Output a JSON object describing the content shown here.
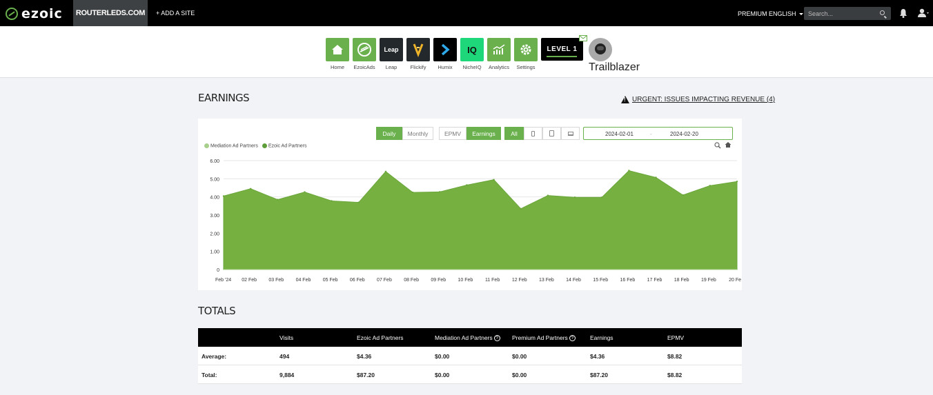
{
  "topbar": {
    "logo_text": "ezoic",
    "site": "ROUTERLEDS.COM",
    "add_site": "+ ADD A SITE",
    "premium": "PREMIUM",
    "language": "ENGLISH",
    "search_placeholder": "Search..."
  },
  "apps": [
    {
      "label": "Home",
      "icon": "home-icon"
    },
    {
      "label": "EzoicAds",
      "icon": "ezoicads-icon"
    },
    {
      "label": "Leap",
      "icon": "leap-icon",
      "tile_text": "Leap"
    },
    {
      "label": "Flickify",
      "icon": "flickify-icon"
    },
    {
      "label": "Humix",
      "icon": "humix-icon"
    },
    {
      "label": "NicheIQ",
      "icon": "nicheiq-icon",
      "tile_text": "IQ"
    },
    {
      "label": "Analytics",
      "icon": "analytics-icon"
    },
    {
      "label": "Settings",
      "icon": "gear-icon"
    }
  ],
  "level_badge": "LEVEL 1",
  "trailblazer_label": "Trailblazer",
  "earnings": {
    "title": "EARNINGS",
    "urgent": "URGENT: ISSUES IMPACTING REVENUE (4)",
    "toggles": {
      "daily": "Daily",
      "monthly": "Monthly",
      "epmv": "EPMV",
      "earnings": "Earnings",
      "all": "All"
    },
    "date_from": "2024-02-01",
    "date_sep": "-",
    "date_to": "2024-02-20",
    "legend": [
      "Mediation Ad Partners",
      "Ezoic Ad Partners"
    ]
  },
  "chart_data": {
    "type": "area",
    "x": [
      "Feb '24",
      "02 Feb",
      "03 Feb",
      "04 Feb",
      "05 Feb",
      "06 Feb",
      "07 Feb",
      "08 Feb",
      "09 Feb",
      "10 Feb",
      "11 Feb",
      "12 Feb",
      "13 Feb",
      "14 Feb",
      "15 Feb",
      "16 Feb",
      "17 Feb",
      "18 Feb",
      "19 Feb",
      "20 Fe"
    ],
    "series": [
      {
        "name": "Mediation Ad Partners",
        "values": [
          0,
          0,
          0,
          0,
          0,
          0,
          0,
          0,
          0,
          0,
          0,
          0,
          0,
          0,
          0,
          0,
          0,
          0,
          0,
          0
        ]
      },
      {
        "name": "Ezoic Ad Partners",
        "values": [
          4.05,
          4.45,
          3.85,
          4.27,
          3.78,
          3.7,
          5.4,
          4.25,
          4.28,
          4.65,
          4.95,
          3.35,
          4.08,
          3.98,
          3.98,
          5.45,
          5.07,
          4.1,
          4.62,
          4.85
        ]
      }
    ],
    "yticks": [
      "0",
      "1.00",
      "2.00",
      "3.00",
      "4.00",
      "5.00",
      "6.00"
    ],
    "ylim": [
      0,
      6
    ],
    "colors": {
      "ezoic": "#76b041",
      "mediation": "#a8d08d"
    },
    "grid": true,
    "legend_position": "top-left"
  },
  "totals": {
    "title": "TOTALS",
    "headers": [
      "Visits",
      "Ezoic Ad Partners",
      "Mediation Ad Partners",
      "Premium Ad Partners",
      "Earnings",
      "EPMV"
    ],
    "rows": [
      {
        "label": "Average:",
        "values": [
          "494",
          "$4.36",
          "$0.00",
          "$0.00",
          "$4.36",
          "$8.82"
        ]
      },
      {
        "label": "Total:",
        "values": [
          "9,884",
          "$87.20",
          "$0.00",
          "$0.00",
          "$87.20",
          "$8.82"
        ]
      }
    ]
  }
}
